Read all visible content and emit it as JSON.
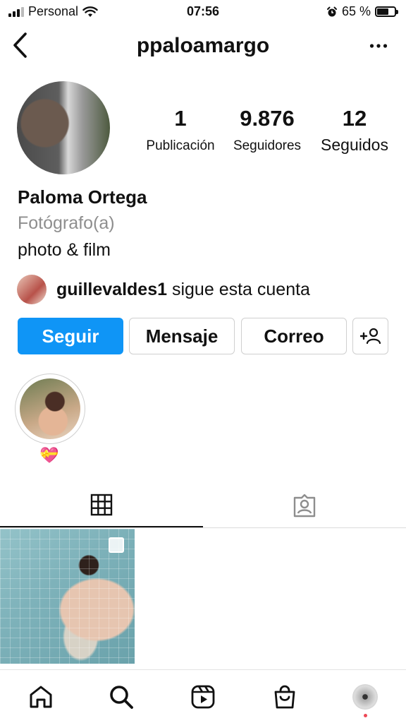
{
  "status_bar": {
    "carrier": "Personal",
    "time": "07:56",
    "battery_percent": "65 %",
    "battery_level": 0.65
  },
  "header": {
    "username": "ppaloamargo",
    "back_icon": "chevron-left-icon",
    "more_icon": "more-horizontal-icon"
  },
  "profile": {
    "stats": [
      {
        "value": "1",
        "label": "Publicación"
      },
      {
        "value": "9.876",
        "label": "Seguidores"
      },
      {
        "value": "12",
        "label": "Seguidos"
      }
    ],
    "full_name": "Paloma Ortega",
    "category": "Fotógrafo(a)",
    "bio": "photo & film",
    "followed_by": {
      "username": "guillevaldes1",
      "text": " sigue esta cuenta"
    }
  },
  "actions": {
    "follow": "Seguir",
    "message": "Mensaje",
    "email": "Correo",
    "add_user_icon": "add-user-icon"
  },
  "highlights": [
    {
      "label": "💝"
    }
  ],
  "tabs": [
    {
      "icon": "grid-icon",
      "selected": true
    },
    {
      "icon": "tagged-icon",
      "selected": false
    }
  ],
  "bottom_nav": [
    "home-icon",
    "search-icon",
    "reels-icon",
    "shop-icon",
    "profile-avatar"
  ],
  "colors": {
    "accent": "#0f95f6",
    "secondary_text": "#8e8e8e",
    "notification_dot": "#ed4956"
  }
}
